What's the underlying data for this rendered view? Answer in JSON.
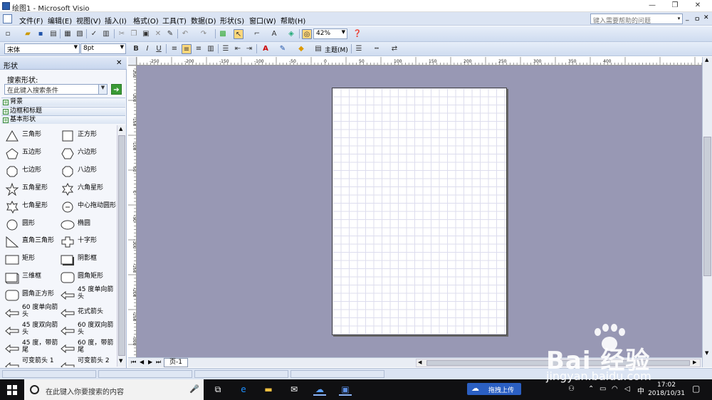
{
  "titlebar": {
    "title": "绘图1 - Microsoft Visio",
    "minimize": "—",
    "restore": "❐",
    "close": "✕"
  },
  "menubar": {
    "items": [
      "文件(F)",
      "编辑(E)",
      "视图(V)",
      "插入(I)",
      "格式(O)",
      "工具(T)",
      "数据(D)",
      "形状(S)",
      "窗口(W)",
      "帮助(H)"
    ],
    "help_placeholder": "键入需要帮助的问题",
    "help_arrow": "▾",
    "mdi": [
      "_",
      "ㅁ",
      "✕"
    ]
  },
  "toolbar": {
    "zoom": "42%",
    "font": "宋体",
    "size": "8pt",
    "theme": "主题(M)"
  },
  "shapes_pane": {
    "title": "形状",
    "close": "✕",
    "search_label": "搜索形状:",
    "search_placeholder": "在此键入搜索条件",
    "go": "➔",
    "stencils": [
      "背景",
      "边框和标题",
      "基本形状"
    ],
    "shapes": [
      {
        "label": "三角形",
        "icon": "triangle-icon"
      },
      {
        "label": "正方形",
        "icon": "square-icon"
      },
      {
        "label": "五边形",
        "icon": "pentagon-icon"
      },
      {
        "label": "六边形",
        "icon": "hexagon-icon"
      },
      {
        "label": "七边形",
        "icon": "heptagon-icon"
      },
      {
        "label": "八边形",
        "icon": "octagon-icon"
      },
      {
        "label": "五角星形",
        "icon": "five-point-star-icon"
      },
      {
        "label": "六角星形",
        "icon": "six-point-star-icon"
      },
      {
        "label": "七角星形",
        "icon": "seven-point-star-icon"
      },
      {
        "label": "中心拖动圆形",
        "icon": "center-drag-circle-icon"
      },
      {
        "label": "圆形",
        "icon": "circle-icon"
      },
      {
        "label": "椭圆",
        "icon": "ellipse-icon"
      },
      {
        "label": "直角三角形",
        "icon": "right-triangle-icon"
      },
      {
        "label": "十字形",
        "icon": "cross-icon"
      },
      {
        "label": "矩形",
        "icon": "rectangle-icon"
      },
      {
        "label": "阴影框",
        "icon": "shadow-box-icon"
      },
      {
        "label": "三维框",
        "icon": "3d-box-icon"
      },
      {
        "label": "圆角矩形",
        "icon": "rounded-rectangle-icon"
      },
      {
        "label": "圆角正方形",
        "icon": "rounded-square-icon"
      },
      {
        "label": "45 度单向箭头",
        "icon": "45-single-arrow-icon"
      },
      {
        "label": "60 度单向箭头",
        "icon": "60-single-arrow-icon"
      },
      {
        "label": "花式箭头",
        "icon": "fancy-arrow-icon"
      },
      {
        "label": "45 度双向箭头",
        "icon": "45-double-arrow-icon"
      },
      {
        "label": "60 度双向箭头",
        "icon": "60-double-arrow-icon"
      },
      {
        "label": "45 度，带箭尾",
        "icon": "45-tailed-arrow-icon"
      },
      {
        "label": "60 度，带箭尾",
        "icon": "60-tailed-arrow-icon"
      },
      {
        "label": "可变箭头 1",
        "icon": "variable-arrow-1-icon"
      },
      {
        "label": "可变箭头 2",
        "icon": "variable-arrow-2-icon"
      }
    ]
  },
  "ruler_top": [
    "-250",
    "-200",
    "-150",
    "-100",
    "-50",
    "0",
    "50",
    "100",
    "150",
    "200",
    "250",
    "300",
    "350",
    "400"
  ],
  "ruler_left": [
    "250",
    "200",
    "150",
    "100",
    "50",
    "0",
    "-50",
    "-100",
    "-150",
    "-200",
    "-250",
    "-300"
  ],
  "page_tab": "页-1",
  "taskbar": {
    "search_placeholder": "在此键入你要搜索的内容",
    "upload_label": "拖拽上传",
    "ime": "中",
    "time": "17:02",
    "date": "2018/10/31"
  },
  "watermark": {
    "brand": "Bai 经验",
    "url": "jingyan.baidu.com"
  },
  "colors": {
    "canvas": "#9898b4",
    "menubar": "#dbe4f3",
    "taskbar": "#101012",
    "upload": "#2b5fc2"
  }
}
